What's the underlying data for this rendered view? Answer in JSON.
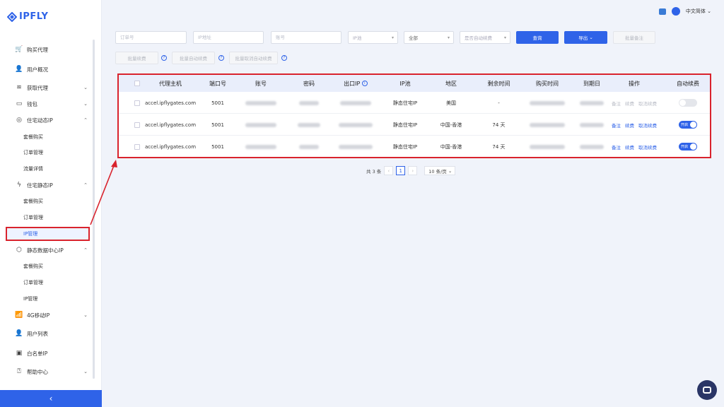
{
  "brand": {
    "name": "IPFLY"
  },
  "header": {
    "language": "中文简体"
  },
  "sidebar": {
    "items": [
      {
        "label": "购买代理",
        "icon": "cart-icon"
      },
      {
        "label": "用户概况",
        "icon": "user-icon"
      },
      {
        "label": "获取代理",
        "icon": "database-icon"
      },
      {
        "label": "钱包",
        "icon": "wallet-icon"
      },
      {
        "label": "住宅动态IP",
        "icon": "globe-icon"
      },
      {
        "label": "套餐购买"
      },
      {
        "label": "订单管理"
      },
      {
        "label": "流量详情"
      },
      {
        "label": "住宅静态IP",
        "icon": "bolt-icon"
      },
      {
        "label": "套餐购买"
      },
      {
        "label": "订单管理"
      },
      {
        "label": "IP管理"
      },
      {
        "label": "静态数据中心IP",
        "icon": "cube-icon"
      },
      {
        "label": "套餐购买"
      },
      {
        "label": "订单管理"
      },
      {
        "label": "IP管理"
      },
      {
        "label": "4G移动IP",
        "icon": "signal-icon"
      },
      {
        "label": "用户列表",
        "icon": "users-icon"
      },
      {
        "label": "白名单IP",
        "icon": "shield-icon"
      },
      {
        "label": "帮助中心",
        "icon": "help-icon"
      }
    ]
  },
  "filters": {
    "order_no_placeholder": "订单号",
    "ip_placeholder": "IP地址",
    "account_placeholder": "账号",
    "pool_placeholder": "IP池",
    "status_value": "全部",
    "auto_renew_placeholder": "是否自动续费",
    "search_label": "查询",
    "export_label": "导出",
    "batch_remark_label": "批量备注",
    "batch_renew_label": "批量续费",
    "batch_auto_renew_label": "批量自动续费",
    "batch_cancel_auto_label": "批量取消自动续费"
  },
  "table": {
    "columns": [
      "代理主机",
      "端口号",
      "账号",
      "密码",
      "出口IP",
      "IP池",
      "地区",
      "剩余时间",
      "购买时间",
      "到期日",
      "操作",
      "自动续费"
    ],
    "rows": [
      {
        "host": "accel.ipflygates.com",
        "port": "5001",
        "pool": "静态住宅IP",
        "region": "美国",
        "remaining": "-",
        "actions": [
          "备注",
          "续费",
          "取消续费"
        ],
        "auto_renew": "",
        "auto_on": false
      },
      {
        "host": "accel.ipflygates.com",
        "port": "5001",
        "pool": "静态住宅IP",
        "region": "中国-香港",
        "remaining": "74 天",
        "actions": [
          "备注",
          "续费",
          "取消续费"
        ],
        "auto_renew": "开启",
        "auto_on": true
      },
      {
        "host": "accel.ipflygates.com",
        "port": "5001",
        "pool": "静态住宅IP",
        "region": "中国-香港",
        "remaining": "74 天",
        "actions": [
          "备注",
          "续费",
          "取消续费"
        ],
        "auto_renew": "开启",
        "auto_on": true
      }
    ]
  },
  "pagination": {
    "total": "共 3 条",
    "current": "1",
    "page_size": "10 条/页"
  },
  "colors": {
    "primary": "#2f63e8",
    "highlight": "#d9232d"
  }
}
